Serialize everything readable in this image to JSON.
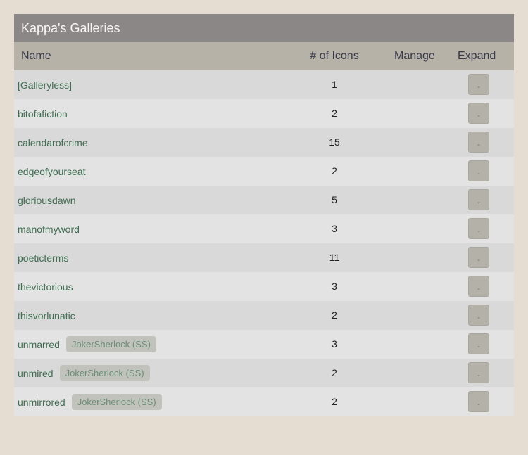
{
  "panel": {
    "title": "Kappa's Galleries"
  },
  "headers": {
    "name": "Name",
    "icons": "# of Icons",
    "manage": "Manage",
    "expand": "Expand"
  },
  "rows": [
    {
      "name": "[Galleryless]",
      "count": "1",
      "tag": null
    },
    {
      "name": "bitofafiction",
      "count": "2",
      "tag": null
    },
    {
      "name": "calendarofcrime",
      "count": "15",
      "tag": null
    },
    {
      "name": "edgeofyourseat",
      "count": "2",
      "tag": null
    },
    {
      "name": "gloriousdawn",
      "count": "5",
      "tag": null
    },
    {
      "name": "manofmyword",
      "count": "3",
      "tag": null
    },
    {
      "name": "poeticterms",
      "count": "11",
      "tag": null
    },
    {
      "name": "thevictorious",
      "count": "3",
      "tag": null
    },
    {
      "name": "thisvorlunatic",
      "count": "2",
      "tag": null
    },
    {
      "name": "unmarred",
      "count": "3",
      "tag": "JokerSherlock (SS)"
    },
    {
      "name": "unmired",
      "count": "2",
      "tag": "JokerSherlock (SS)"
    },
    {
      "name": "unmirrored",
      "count": "2",
      "tag": "JokerSherlock (SS)"
    }
  ],
  "icons": {
    "expand": "chevron-down-icon"
  },
  "colors": {
    "page_background": "#e5ddd1",
    "title_bar": "#8c8787",
    "header_bar": "#b6b2a8",
    "row_odd": "#d9d9d9",
    "row_even": "#e3e3e3",
    "link": "#3e6d50"
  }
}
